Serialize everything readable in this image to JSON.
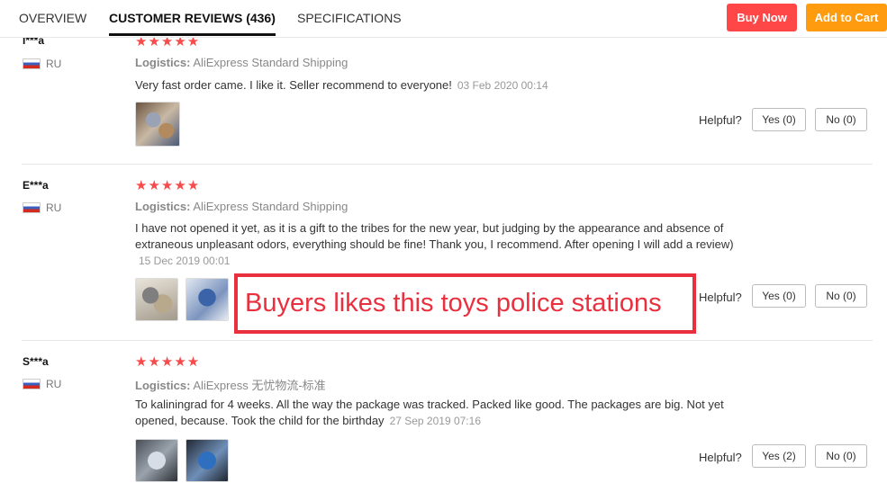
{
  "tabs": [
    {
      "label": "OVERVIEW"
    },
    {
      "label": "CUSTOMER REVIEWS (436)"
    },
    {
      "label": "SPECIFICATIONS"
    }
  ],
  "buttons": {
    "buy_now": "Buy Now",
    "add_to_cart": "Add to Cart"
  },
  "logistics_label": "Logistics:",
  "helpful_label": "Helpful?",
  "stars_text": "★★★★★",
  "reviews": [
    {
      "user": "I***a",
      "country": "RU",
      "rating": 5,
      "logistics": "AliExpress Standard Shipping",
      "text": "Very fast order came. I like it. Seller recommend to everyone!",
      "date": "03 Feb 2020 00:14",
      "yes": "Yes (0)",
      "no": "No (0)"
    },
    {
      "user": "E***a",
      "country": "RU",
      "rating": 5,
      "logistics": "AliExpress Standard Shipping",
      "text": "I have not opened it yet, as it is a gift to the tribes for the new year, but judging by the appearance and absence of extraneous unpleasant odors, everything should be fine! Thank you, I recommend. After opening I will add a review)",
      "date": "15 Dec 2019 00:01",
      "yes": "Yes (0)",
      "no": "No (0)"
    },
    {
      "user": "S***a",
      "country": "RU",
      "rating": 5,
      "logistics": "AliExpress 无忧物流-标准",
      "text": "To kaliningrad for 4 weeks. All the way the package was tracked. Packed like good. The packages are big. Not yet opened, because. Took the child for the birthday",
      "date": "27 Sep 2019 07:16",
      "yes": "Yes (2)",
      "no": "No (0)"
    }
  ],
  "annotation": "Buyers likes this toys police stations"
}
